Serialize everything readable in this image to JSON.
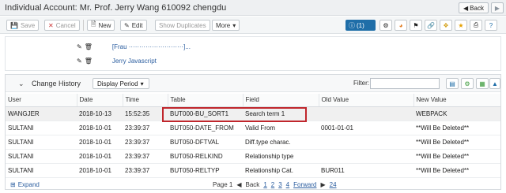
{
  "header": {
    "title": "Individual Account: Mr. Prof. Jerry Wang 610092 chengdu",
    "back_label": "Back"
  },
  "toolbar": {
    "save": "Save",
    "cancel": "Cancel",
    "new": "New",
    "edit": "Edit",
    "show_duplicates": "Show Duplicates",
    "more": "More",
    "info_count": "(1)"
  },
  "notes": {
    "items": [
      {
        "text": "[Frau ··························]..."
      },
      {
        "text": "Jerry Javascript"
      }
    ]
  },
  "change_history": {
    "title": "Change History",
    "display_period": "Display Period",
    "filter_label": "Filter:",
    "filter_value": "",
    "columns": [
      "User",
      "Date",
      "Time",
      "Table",
      "Field",
      "Old Value",
      "New Value"
    ],
    "rows": [
      {
        "user": "WANGJER",
        "date": "2018-10-13",
        "time": "15:52:35",
        "table": "BUT000-BU_SORT1",
        "field": "Search term 1",
        "old": "",
        "new": "WEBPACK"
      },
      {
        "user": "SULTANI",
        "date": "2018-10-01",
        "time": "23:39:37",
        "table": "BUT050-DATE_FROM",
        "field": "Valid From",
        "old": "0001-01-01",
        "new": "**Will Be Deleted**"
      },
      {
        "user": "SULTANI",
        "date": "2018-10-01",
        "time": "23:39:37",
        "table": "BUT050-DFTVAL",
        "field": "Diff.type charac.",
        "old": "",
        "new": "**Will Be Deleted**"
      },
      {
        "user": "SULTANI",
        "date": "2018-10-01",
        "time": "23:39:37",
        "table": "BUT050-RELKIND",
        "field": "Relationship type",
        "old": "",
        "new": "**Will Be Deleted**"
      },
      {
        "user": "SULTANI",
        "date": "2018-10-01",
        "time": "23:39:37",
        "table": "BUT050-RELTYP",
        "field": "Relationship Cat.",
        "old": "BUR011",
        "new": "**Will Be Deleted**"
      }
    ],
    "expand": "Expand",
    "pager": {
      "page": "Page 1",
      "back": "Back",
      "p1": "1",
      "p2": "2",
      "p3": "3",
      "p4": "4",
      "forward": "Forward",
      "last": "24"
    }
  },
  "colors": {
    "accent": "#1f6ea8",
    "highlight": "#c0262c",
    "link": "#2a5d9f"
  }
}
